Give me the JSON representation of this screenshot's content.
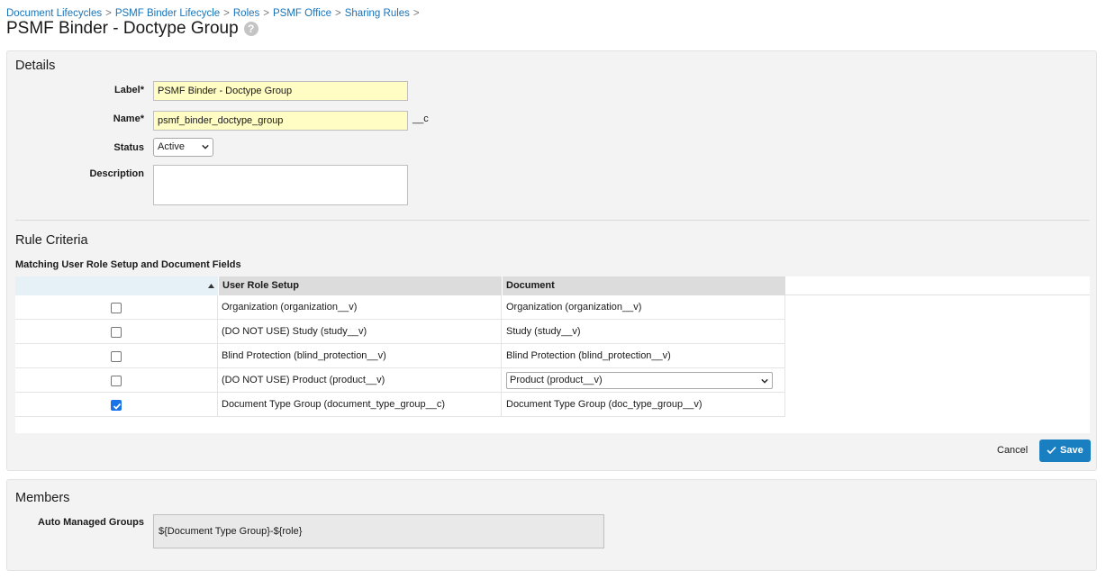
{
  "breadcrumb": {
    "items": [
      "Document Lifecycles",
      "PSMF Binder Lifecycle",
      "Roles",
      "PSMF Office",
      "Sharing Rules"
    ],
    "separator": ">"
  },
  "page": {
    "title": "PSMF Binder - Doctype Group",
    "help_glyph": "?"
  },
  "details": {
    "title": "Details",
    "label_label": "Label*",
    "label_value": "PSMF Binder - Doctype Group",
    "name_label": "Name*",
    "name_value": "psmf_binder_doctype_group",
    "name_suffix": "__c",
    "status_label": "Status",
    "status_value": "Active",
    "description_label": "Description",
    "description_value": ""
  },
  "rule_criteria": {
    "title": "Rule Criteria",
    "subtitle": "Matching User Role Setup and Document Fields",
    "columns": [
      "User Role Setup",
      "Document"
    ],
    "rows": [
      {
        "checked": false,
        "role": "Organization (organization__v)",
        "document": "Organization (organization__v)",
        "document_is_select": false
      },
      {
        "checked": false,
        "role": "(DO NOT USE) Study (study__v)",
        "document": "Study (study__v)",
        "document_is_select": false
      },
      {
        "checked": false,
        "role": "Blind Protection (blind_protection__v)",
        "document": "Blind Protection (blind_protection__v)",
        "document_is_select": false
      },
      {
        "checked": false,
        "role": "(DO NOT USE) Product (product__v)",
        "document": "Product (product__v)",
        "document_is_select": true
      },
      {
        "checked": true,
        "role": "Document Type Group (document_type_group__c)",
        "document": "Document Type Group (doc_type_group__v)",
        "document_is_select": false
      }
    ]
  },
  "actions": {
    "cancel_label": "Cancel",
    "save_label": "Save"
  },
  "members": {
    "title": "Members",
    "auto_groups_label": "Auto Managed Groups",
    "auto_groups_value": "${Document Type Group}-${role}"
  },
  "colors": {
    "link": "#1a73b8",
    "save_button": "#1a7fc1",
    "required_field_bg": "#fffcc4",
    "panel_bg": "#f3f3f3",
    "checkbox_checked": "#1a73e8"
  }
}
